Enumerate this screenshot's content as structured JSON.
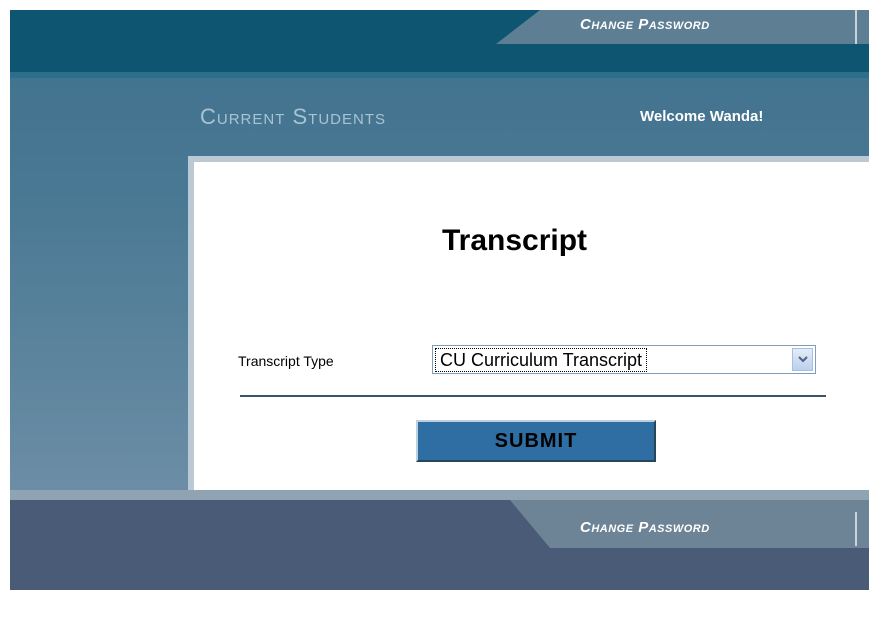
{
  "header": {
    "change_password_top": "Change Password"
  },
  "section": {
    "title": "Current Students",
    "welcome": "Welcome Wanda!"
  },
  "form": {
    "title": "Transcript",
    "transcript_type_label": "Transcript Type",
    "transcript_type_value": "CU Curriculum Transcript",
    "submit_label": "SUBMIT"
  },
  "footer": {
    "change_password_bottom": "Change Password"
  },
  "icons": {
    "dropdown": "chevron-down-icon"
  }
}
